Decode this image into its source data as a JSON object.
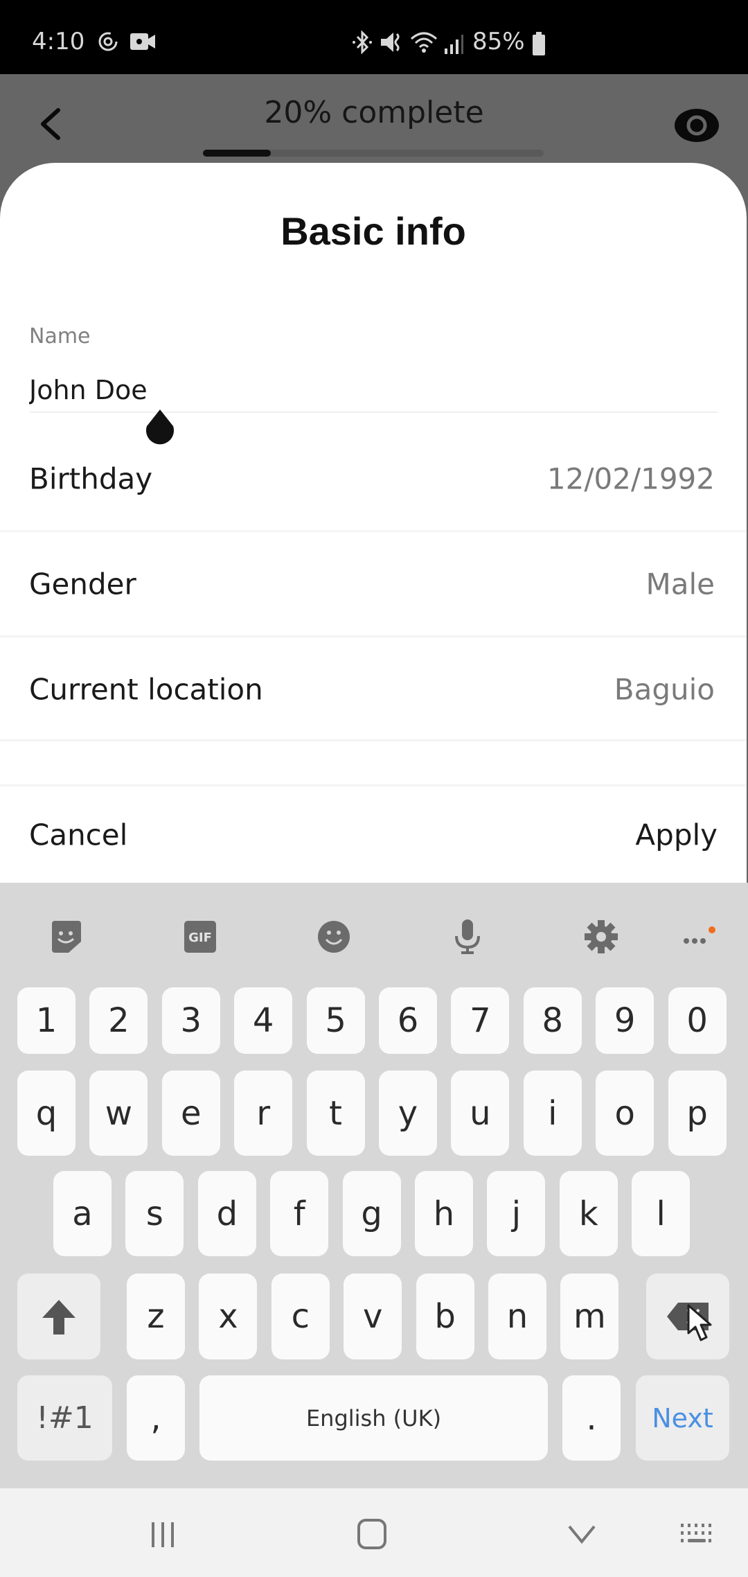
{
  "status_bar": {
    "time": "4:10",
    "battery": "85%",
    "left_icons": [
      "sync-icon",
      "video-recording-icon"
    ],
    "right_icons": [
      "bluetooth-icon",
      "mute-icon",
      "wifi-icon",
      "signal-icon",
      "battery-icon"
    ]
  },
  "header": {
    "title": "20% complete",
    "progress_percent": 20,
    "back_icon": "chevron-left-icon",
    "preview_icon": "eye-icon"
  },
  "sheet": {
    "title": "Basic info",
    "name": {
      "label": "Name",
      "value": "John Doe"
    },
    "rows": [
      {
        "label": "Birthday",
        "value": "12/02/1992"
      },
      {
        "label": "Gender",
        "value": "Male"
      },
      {
        "label": "Current location",
        "value": "Baguio"
      }
    ],
    "cancel_label": "Cancel",
    "apply_label": "Apply"
  },
  "keyboard": {
    "toolbar": [
      "sticker-icon",
      "gif-icon",
      "emoji-icon",
      "microphone-icon",
      "settings-icon",
      "more-icon"
    ],
    "gif_label": "GIF",
    "accent_color": "#4a90e2",
    "notification_dot_color": "#f26b1d",
    "rows": [
      [
        "1",
        "2",
        "3",
        "4",
        "5",
        "6",
        "7",
        "8",
        "9",
        "0"
      ],
      [
        "q",
        "w",
        "e",
        "r",
        "t",
        "y",
        "u",
        "i",
        "o",
        "p"
      ],
      [
        "a",
        "s",
        "d",
        "f",
        "g",
        "h",
        "j",
        "k",
        "l"
      ],
      [
        "z",
        "x",
        "c",
        "v",
        "b",
        "n",
        "m"
      ]
    ],
    "symbols_label": "!#1",
    "comma_label": ",",
    "space_label": "English (UK)",
    "period_label": ".",
    "next_label": "Next"
  },
  "nav_bar": {
    "items": [
      "recent-apps-icon",
      "home-icon",
      "hide-keyboard-icon",
      "keyboard-switch-icon"
    ]
  }
}
